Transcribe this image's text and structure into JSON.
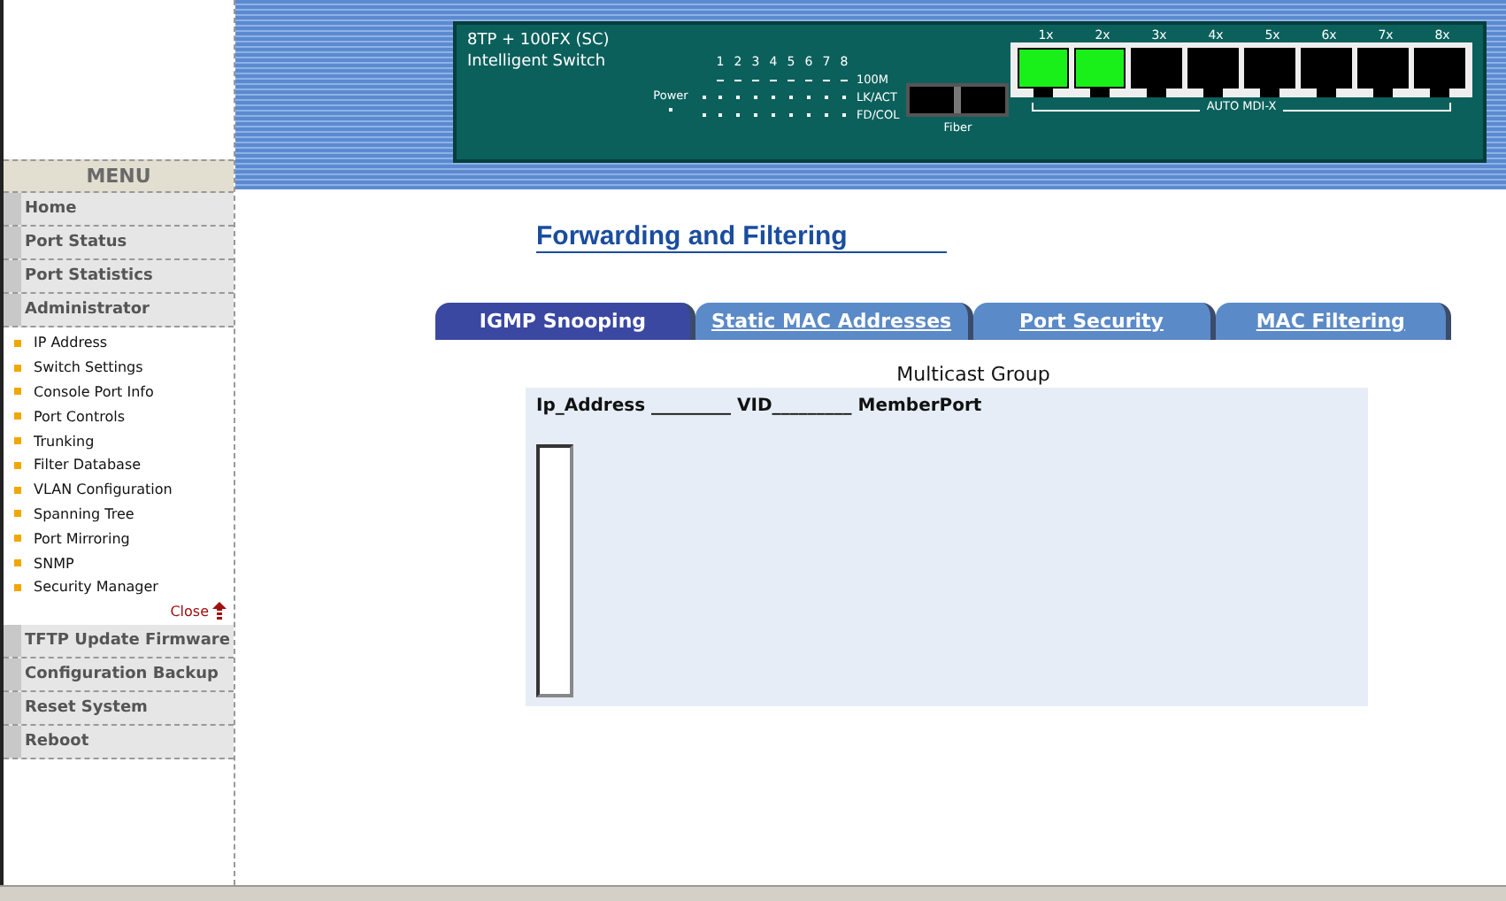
{
  "device": {
    "model": "8TP + 100FX (SC)",
    "name": "Intelligent Switch",
    "led_numbers": [
      "1",
      "2",
      "3",
      "4",
      "5",
      "6",
      "7",
      "8"
    ],
    "led_rows": [
      {
        "label": "100M",
        "kind": "dash"
      },
      {
        "label": "LK/ACT",
        "kind": "dot"
      },
      {
        "label": "FD/COL",
        "kind": "dot"
      }
    ],
    "power_label": "Power",
    "fiber_label": "Fiber",
    "ports": [
      {
        "label": "1x",
        "link": true
      },
      {
        "label": "2x",
        "link": true
      },
      {
        "label": "3x",
        "link": false
      },
      {
        "label": "4x",
        "link": false
      },
      {
        "label": "5x",
        "link": false
      },
      {
        "label": "6x",
        "link": false
      },
      {
        "label": "7x",
        "link": false
      },
      {
        "label": "8x",
        "link": false
      }
    ],
    "mdix_label": "AUTO MDI-X"
  },
  "menu": {
    "title": "MENU",
    "items": [
      {
        "label": "Home"
      },
      {
        "label": "Port Status"
      },
      {
        "label": "Port Statistics"
      },
      {
        "label": "Administrator",
        "close_label": "Close",
        "children": [
          {
            "label": "IP Address"
          },
          {
            "label": "Switch Settings"
          },
          {
            "label": "Console Port Info"
          },
          {
            "label": "Port Controls"
          },
          {
            "label": "Trunking"
          },
          {
            "label": "Filter Database"
          },
          {
            "label": "VLAN Configuration"
          },
          {
            "label": "Spanning Tree"
          },
          {
            "label": "Port Mirroring"
          },
          {
            "label": "SNMP"
          },
          {
            "label": "Security Manager"
          }
        ]
      },
      {
        "label": "TFTP Update Firmware"
      },
      {
        "label": "Configuration Backup"
      },
      {
        "label": "Reset System"
      },
      {
        "label": "Reboot"
      }
    ]
  },
  "page": {
    "title": "Forwarding and Filtering",
    "tabs": [
      {
        "label": "IGMP Snooping",
        "selected": true
      },
      {
        "label": "Static MAC Addresses",
        "selected": false
      },
      {
        "label": "Port Security",
        "selected": false
      },
      {
        "label": "MAC Filtering",
        "selected": false
      }
    ],
    "group_title": "Multicast Group",
    "table_header": "Ip_Address _________ VID_________ MemberPort"
  }
}
